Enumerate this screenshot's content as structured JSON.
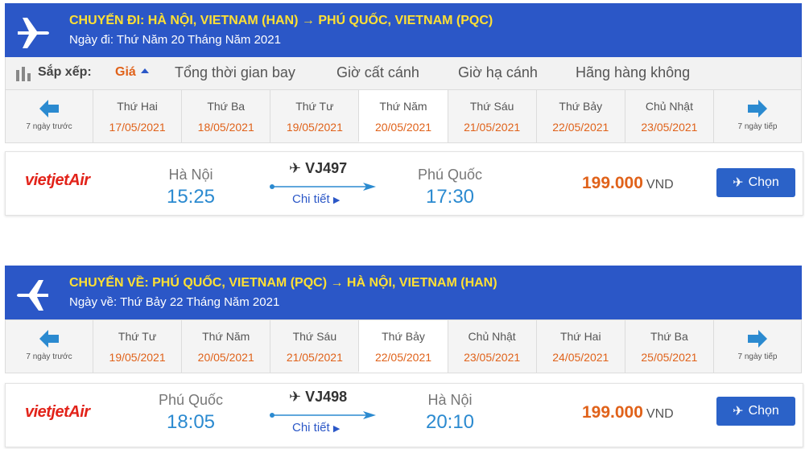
{
  "outbound": {
    "header": {
      "title": "CHUYẾN ĐI: HÀ NỘI, VIETNAM (HAN) → PHÚ QUỐC, VIETNAM (PQC)",
      "date": "Ngày đi: Thứ Năm 20 Tháng Năm 2021",
      "icon": "airplane-icon"
    },
    "sort": {
      "label": "Sắp xếp:",
      "options": [
        "Giá",
        "Tổng thời gian bay",
        "Giờ cất cánh",
        "Giờ hạ cánh",
        "Hãng hàng không"
      ],
      "active": "Giá"
    },
    "days": {
      "prev_label": "7 ngày trước",
      "next_label": "7 ngày tiếp",
      "items": [
        {
          "name": "Thứ Hai",
          "date": "17/05/2021"
        },
        {
          "name": "Thứ Ba",
          "date": "18/05/2021"
        },
        {
          "name": "Thứ Tư",
          "date": "19/05/2021"
        },
        {
          "name": "Thứ Năm",
          "date": "20/05/2021"
        },
        {
          "name": "Thứ Sáu",
          "date": "21/05/2021"
        },
        {
          "name": "Thứ Bảy",
          "date": "22/05/2021"
        },
        {
          "name": "Chủ Nhật",
          "date": "23/05/2021"
        }
      ],
      "selected_index": 3
    },
    "flight": {
      "airline": "vietjetAir",
      "from_city": "Hà Nội",
      "depart_time": "15:25",
      "flight_no": "VJ497",
      "detail": "Chi tiết",
      "to_city": "Phú Quốc",
      "arrive_time": "17:30",
      "price": "199.000",
      "currency": "VND",
      "button": "Chọn"
    }
  },
  "return": {
    "header": {
      "title": "CHUYẾN VỀ: PHÚ QUỐC, VIETNAM (PQC) → HÀ NỘI, VIETNAM (HAN)",
      "date": "Ngày về: Thứ Bảy 22 Tháng Năm 2021",
      "icon": "airplane-icon"
    },
    "days": {
      "prev_label": "7 ngày trước",
      "next_label": "7 ngày tiếp",
      "items": [
        {
          "name": "Thứ Tư",
          "date": "19/05/2021"
        },
        {
          "name": "Thứ Năm",
          "date": "20/05/2021"
        },
        {
          "name": "Thứ Sáu",
          "date": "21/05/2021"
        },
        {
          "name": "Thứ Bảy",
          "date": "22/05/2021"
        },
        {
          "name": "Chủ Nhật",
          "date": "23/05/2021"
        },
        {
          "name": "Thứ Hai",
          "date": "24/05/2021"
        },
        {
          "name": "Thứ Ba",
          "date": "25/05/2021"
        }
      ],
      "selected_index": 3
    },
    "flight": {
      "airline": "vietjetAir",
      "from_city": "Phú Quốc",
      "depart_time": "18:05",
      "flight_no": "VJ498",
      "detail": "Chi tiết",
      "to_city": "Hà Nội",
      "arrive_time": "20:10",
      "price": "199.000",
      "currency": "VND",
      "button": "Chọn"
    }
  },
  "colors": {
    "header_bg": "#2b57c7",
    "title_yellow": "#ffe033",
    "accent_orange": "#e0621a",
    "time_blue": "#2b8ad0",
    "button_blue": "#2b62c8",
    "logo_red": "#e2231a"
  }
}
